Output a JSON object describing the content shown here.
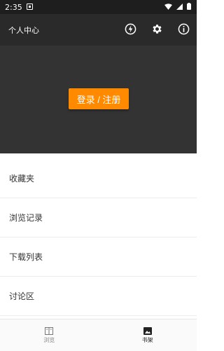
{
  "status_bar": {
    "time": "2:35",
    "icons": [
      "notification-icon",
      "wifi-icon",
      "signal-icon",
      "battery-icon"
    ]
  },
  "header": {
    "title": "个人中心",
    "icons": [
      "flash-icon",
      "settings-icon",
      "info-icon"
    ],
    "login_label": "登录 / 注册"
  },
  "menu": {
    "items": [
      {
        "label": "收藏夹"
      },
      {
        "label": "浏览记录"
      },
      {
        "label": "下载列表"
      },
      {
        "label": "讨论区"
      }
    ]
  },
  "bottom_nav": {
    "items": [
      {
        "label": "浏览",
        "icon": "book-icon",
        "active": false
      },
      {
        "label": "书架",
        "icon": "image-icon",
        "active": true
      }
    ]
  },
  "colors": {
    "accent": "#ff8a00",
    "header_dark": "#2a2a2a",
    "header_body": "#333333"
  }
}
